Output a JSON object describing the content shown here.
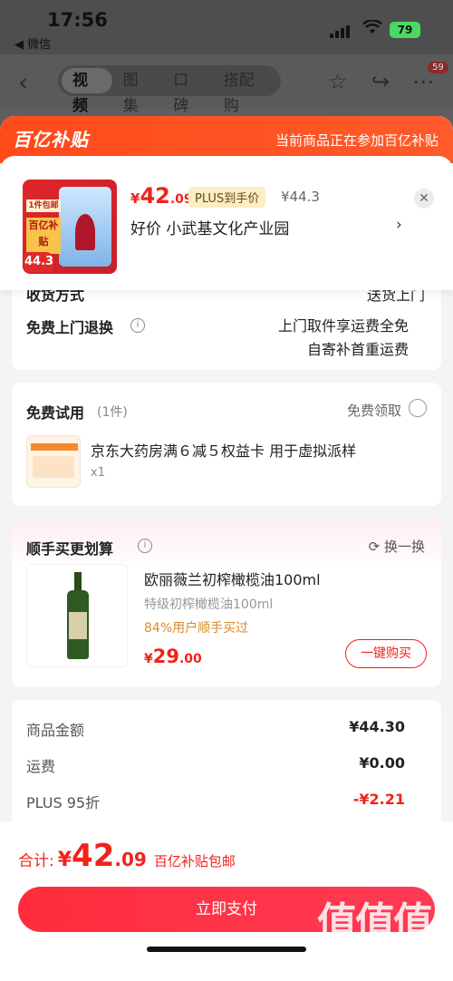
{
  "status": {
    "time": "17:56",
    "back": "◀ 微信",
    "battery": "79"
  },
  "topnav": {
    "tabs": [
      "视频",
      "图集",
      "口碑",
      "搭配购"
    ],
    "badge": "59"
  },
  "banner": {
    "logo": "百亿补贴",
    "note": "当前商品正在参加百亿补贴"
  },
  "product": {
    "price_symbol": "¥",
    "price_int": "42",
    "price_dec": ".09",
    "plus_tag": "PLUS到手价",
    "original_price": "¥44.3",
    "shop": "好价  小武基文化产业园",
    "thumb_badge": "44.3",
    "thumb_tag1": "1件包邮",
    "thumb_tag2": "百亿补贴"
  },
  "delivery": {
    "partial_label": "收货方式",
    "partial_value": "送货上门",
    "free_return_label": "免费上门退换",
    "free_return_line1": "上门取件享运费全免",
    "free_return_line2": "自寄补首重运费"
  },
  "trial": {
    "title": "免费试用",
    "count": "(1件)",
    "claim": "免费领取",
    "item_title": "京东大药房满６减５权益卡 用于虚拟派样",
    "qty": "x1"
  },
  "addon": {
    "title": "顺手买更划算",
    "refresh": "换一换",
    "name": "欧丽薇兰初榨橄榄油100ml",
    "spec": "特级初榨橄榄油100ml",
    "stat": "84%用户顺手买过",
    "price_symbol": "¥",
    "price_int": "29",
    "price_dec": ".00",
    "buy": "一键购买"
  },
  "summary": [
    {
      "label": "商品金额",
      "value": "¥44.30",
      "color": "#222222"
    },
    {
      "label": "运费",
      "value": "¥0.00",
      "color": "#222222"
    },
    {
      "label": "PLUS 95折",
      "value": "-¥2.21",
      "color": "#f0231a"
    }
  ],
  "footer": {
    "total_label": "合计:",
    "cur": "¥",
    "int": "42",
    "dec": ".09",
    "sub": "百亿补贴包邮",
    "pay": "立即支付",
    "wm_chars": "值值值",
    "wm_url": "zhizhizhi.com"
  }
}
